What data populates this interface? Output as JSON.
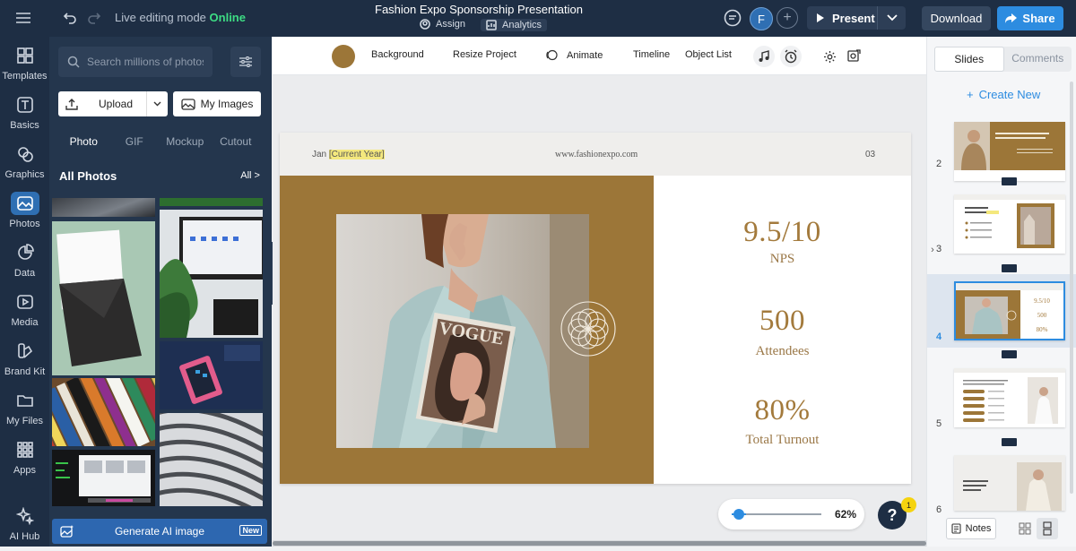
{
  "topbar": {
    "mode_label": "Live editing mode",
    "mode_status": "Online",
    "project_title": "Fashion Expo Sponsorship Presentation",
    "assign_label": "Assign",
    "analytics_label": "Analytics",
    "avatar_initial": "F",
    "present_label": "Present",
    "download_label": "Download",
    "share_label": "Share"
  },
  "leftnav": {
    "items": [
      {
        "label": "Templates",
        "icon": "templates-icon"
      },
      {
        "label": "Basics",
        "icon": "text-icon"
      },
      {
        "label": "Graphics",
        "icon": "graphics-icon"
      },
      {
        "label": "Photos",
        "icon": "photos-icon",
        "active": true
      },
      {
        "label": "Data",
        "icon": "chart-icon"
      },
      {
        "label": "Media",
        "icon": "media-icon"
      },
      {
        "label": "Brand Kit",
        "icon": "brand-kit-icon"
      },
      {
        "label": "My Files",
        "icon": "folder-icon"
      },
      {
        "label": "Apps",
        "icon": "apps-icon"
      },
      {
        "label": "AI Hub",
        "icon": "ai-hub-icon"
      }
    ]
  },
  "panel": {
    "search_placeholder": "Search millions of photos",
    "upload_label": "Upload",
    "myimages_label": "My Images",
    "tabs": [
      "Photo",
      "GIF",
      "Mockup",
      "Cutout"
    ],
    "active_tab": "Photo",
    "section_title": "All Photos",
    "all_link": "All >",
    "generate_label": "Generate AI image",
    "new_badge": "New"
  },
  "toolbar": {
    "background_label": "Background",
    "resize_label": "Resize Project",
    "animate_label": "Animate",
    "timeline_label": "Timeline",
    "objectlist_label": "Object List",
    "background_color": "#9c7638"
  },
  "slide": {
    "date_prefix": "Jan",
    "date_placeholder": "[Current Year]",
    "url": "www.fashionexpo.com",
    "page": "03",
    "stats": [
      {
        "value": "9.5/10",
        "label": "NPS"
      },
      {
        "value": "500",
        "label": "Attendees"
      },
      {
        "value": "80%",
        "label": "Total Turnout"
      }
    ],
    "accent_color": "#9c7638"
  },
  "zoom": {
    "level": "62%",
    "fraction": 0.16
  },
  "help": {
    "label": "?",
    "badge": "1"
  },
  "rightpanel": {
    "tabs": [
      "Slides",
      "Comments"
    ],
    "active_tab": "Slides",
    "create_label": "Create New",
    "slides": [
      {
        "number": "2",
        "text": "We reveal Fashion Expo as an experience, not a storefront."
      },
      {
        "number": "3",
        "text": "This year at Fashion Expo [Current Year]"
      },
      {
        "number": "4",
        "active": true
      },
      {
        "number": "5"
      },
      {
        "number": "6",
        "text": "This year, we're taking it a notch"
      }
    ],
    "notes_label": "Notes"
  }
}
